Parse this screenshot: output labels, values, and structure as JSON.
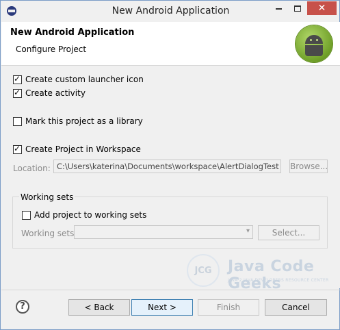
{
  "window": {
    "title": "New Android Application",
    "close_glyph": "✕"
  },
  "banner": {
    "title": "New Android Application",
    "subtitle": "Configure Project"
  },
  "options": {
    "launcher_icon": {
      "label": "Create custom launcher icon",
      "checked": true
    },
    "activity": {
      "label": "Create activity",
      "checked": true
    },
    "library": {
      "label": "Mark this project as a library",
      "checked": false
    },
    "workspace": {
      "label": "Create Project in Workspace",
      "checked": true
    }
  },
  "location": {
    "label": "Location:",
    "value": "C:\\Users\\katerina\\Documents\\workspace\\AlertDialogTest",
    "browse_label": "Browse..."
  },
  "working_sets": {
    "group_title": "Working sets",
    "add_label": "Add project to working sets",
    "add_checked": false,
    "field_label": "Working sets:",
    "select_label": "Select..."
  },
  "watermark": {
    "logo_text": "JCG",
    "name": "Java Code Geeks",
    "tagline": "JAVA 2 JAVA DEVELOPERS RESOURCE CENTER"
  },
  "footer": {
    "help_glyph": "?",
    "back_label": "< Back",
    "next_label": "Next >",
    "finish_label": "Finish",
    "cancel_label": "Cancel"
  },
  "icons": {
    "app": "eclipse-icon",
    "banner_logo": "android-logo-icon",
    "help": "help-icon",
    "dropdown": "chevron-down-icon"
  },
  "colors": {
    "close_button": "#c7514a",
    "default_button_border": "#3c7fb1",
    "android_green": "#8bbd3c"
  }
}
